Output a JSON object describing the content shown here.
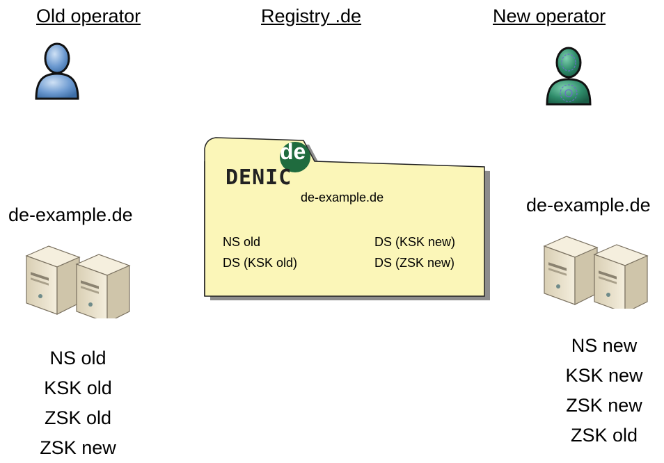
{
  "headers": {
    "old_operator": "Old operator",
    "registry": "Registry .de",
    "new_operator": "New operator"
  },
  "old_side": {
    "domain": "de-example.de",
    "records": [
      "NS old",
      "KSK old",
      "ZSK old",
      "ZSK new"
    ],
    "user_icon": "user-icon",
    "server_icon": "server-icon"
  },
  "registry_box": {
    "logo_text": "DENIC",
    "logo_badge": "de",
    "domain": "de-example.de",
    "left_records": [
      "NS old",
      "DS (KSK old)"
    ],
    "right_records": [
      "DS (KSK new)",
      "DS (ZSK new)"
    ],
    "color": "#FBF6B8"
  },
  "new_side": {
    "domain": "de-example.de",
    "records": [
      "NS new",
      "KSK new",
      "ZSK new",
      "ZSK old"
    ],
    "user_icon": "user-icon",
    "server_icon": "server-icon"
  },
  "colors": {
    "old_user": "#6E9BD1",
    "new_user": "#2E8B6A",
    "denic_green": "#1F6B3E",
    "server": "#E9E1CC"
  }
}
